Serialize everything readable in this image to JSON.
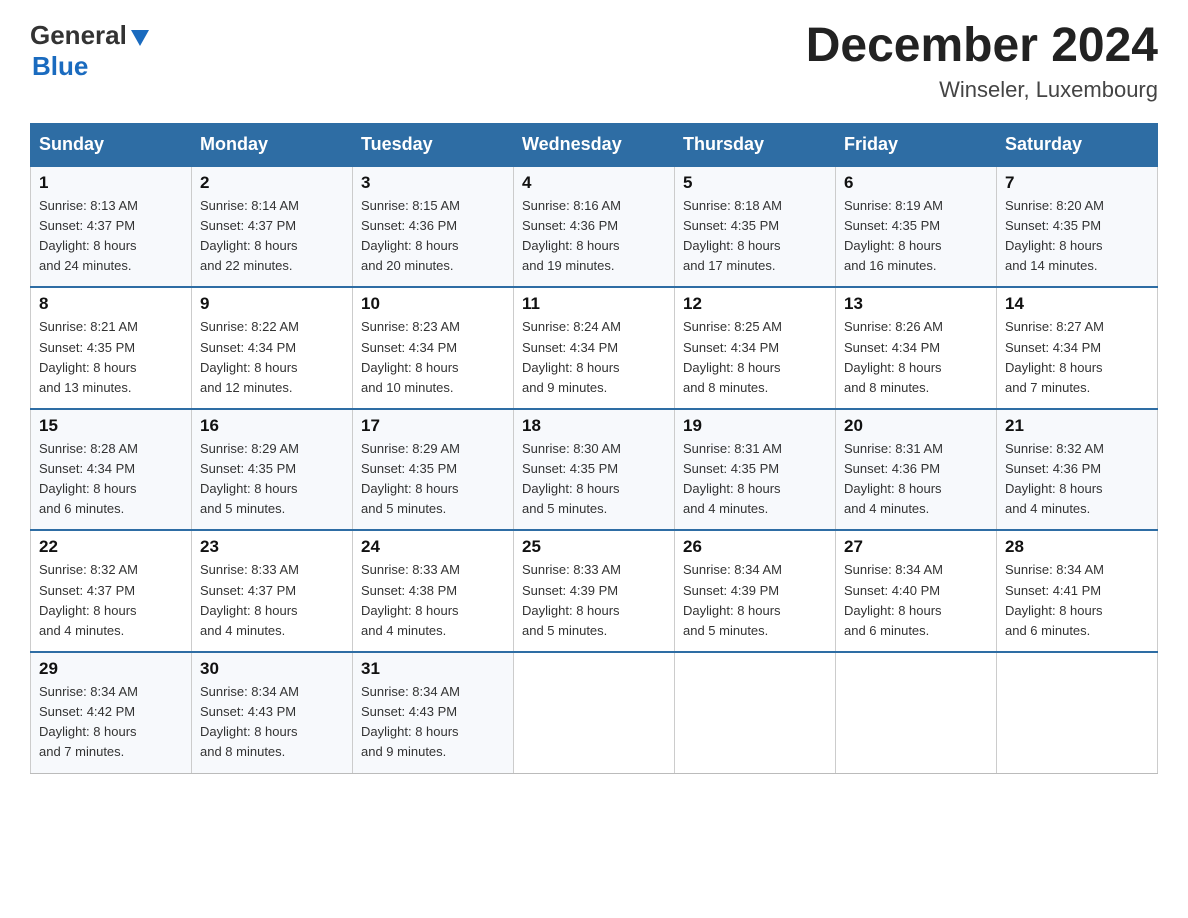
{
  "header": {
    "logo_general": "General",
    "logo_blue": "Blue",
    "main_title": "December 2024",
    "subtitle": "Winseler, Luxembourg"
  },
  "days_of_week": [
    "Sunday",
    "Monday",
    "Tuesday",
    "Wednesday",
    "Thursday",
    "Friday",
    "Saturday"
  ],
  "weeks": [
    [
      {
        "day": "1",
        "sunrise": "8:13 AM",
        "sunset": "4:37 PM",
        "daylight": "8 hours and 24 minutes."
      },
      {
        "day": "2",
        "sunrise": "8:14 AM",
        "sunset": "4:37 PM",
        "daylight": "8 hours and 22 minutes."
      },
      {
        "day": "3",
        "sunrise": "8:15 AM",
        "sunset": "4:36 PM",
        "daylight": "8 hours and 20 minutes."
      },
      {
        "day": "4",
        "sunrise": "8:16 AM",
        "sunset": "4:36 PM",
        "daylight": "8 hours and 19 minutes."
      },
      {
        "day": "5",
        "sunrise": "8:18 AM",
        "sunset": "4:35 PM",
        "daylight": "8 hours and 17 minutes."
      },
      {
        "day": "6",
        "sunrise": "8:19 AM",
        "sunset": "4:35 PM",
        "daylight": "8 hours and 16 minutes."
      },
      {
        "day": "7",
        "sunrise": "8:20 AM",
        "sunset": "4:35 PM",
        "daylight": "8 hours and 14 minutes."
      }
    ],
    [
      {
        "day": "8",
        "sunrise": "8:21 AM",
        "sunset": "4:35 PM",
        "daylight": "8 hours and 13 minutes."
      },
      {
        "day": "9",
        "sunrise": "8:22 AM",
        "sunset": "4:34 PM",
        "daylight": "8 hours and 12 minutes."
      },
      {
        "day": "10",
        "sunrise": "8:23 AM",
        "sunset": "4:34 PM",
        "daylight": "8 hours and 10 minutes."
      },
      {
        "day": "11",
        "sunrise": "8:24 AM",
        "sunset": "4:34 PM",
        "daylight": "8 hours and 9 minutes."
      },
      {
        "day": "12",
        "sunrise": "8:25 AM",
        "sunset": "4:34 PM",
        "daylight": "8 hours and 8 minutes."
      },
      {
        "day": "13",
        "sunrise": "8:26 AM",
        "sunset": "4:34 PM",
        "daylight": "8 hours and 8 minutes."
      },
      {
        "day": "14",
        "sunrise": "8:27 AM",
        "sunset": "4:34 PM",
        "daylight": "8 hours and 7 minutes."
      }
    ],
    [
      {
        "day": "15",
        "sunrise": "8:28 AM",
        "sunset": "4:34 PM",
        "daylight": "8 hours and 6 minutes."
      },
      {
        "day": "16",
        "sunrise": "8:29 AM",
        "sunset": "4:35 PM",
        "daylight": "8 hours and 5 minutes."
      },
      {
        "day": "17",
        "sunrise": "8:29 AM",
        "sunset": "4:35 PM",
        "daylight": "8 hours and 5 minutes."
      },
      {
        "day": "18",
        "sunrise": "8:30 AM",
        "sunset": "4:35 PM",
        "daylight": "8 hours and 5 minutes."
      },
      {
        "day": "19",
        "sunrise": "8:31 AM",
        "sunset": "4:35 PM",
        "daylight": "8 hours and 4 minutes."
      },
      {
        "day": "20",
        "sunrise": "8:31 AM",
        "sunset": "4:36 PM",
        "daylight": "8 hours and 4 minutes."
      },
      {
        "day": "21",
        "sunrise": "8:32 AM",
        "sunset": "4:36 PM",
        "daylight": "8 hours and 4 minutes."
      }
    ],
    [
      {
        "day": "22",
        "sunrise": "8:32 AM",
        "sunset": "4:37 PM",
        "daylight": "8 hours and 4 minutes."
      },
      {
        "day": "23",
        "sunrise": "8:33 AM",
        "sunset": "4:37 PM",
        "daylight": "8 hours and 4 minutes."
      },
      {
        "day": "24",
        "sunrise": "8:33 AM",
        "sunset": "4:38 PM",
        "daylight": "8 hours and 4 minutes."
      },
      {
        "day": "25",
        "sunrise": "8:33 AM",
        "sunset": "4:39 PM",
        "daylight": "8 hours and 5 minutes."
      },
      {
        "day": "26",
        "sunrise": "8:34 AM",
        "sunset": "4:39 PM",
        "daylight": "8 hours and 5 minutes."
      },
      {
        "day": "27",
        "sunrise": "8:34 AM",
        "sunset": "4:40 PM",
        "daylight": "8 hours and 6 minutes."
      },
      {
        "day": "28",
        "sunrise": "8:34 AM",
        "sunset": "4:41 PM",
        "daylight": "8 hours and 6 minutes."
      }
    ],
    [
      {
        "day": "29",
        "sunrise": "8:34 AM",
        "sunset": "4:42 PM",
        "daylight": "8 hours and 7 minutes."
      },
      {
        "day": "30",
        "sunrise": "8:34 AM",
        "sunset": "4:43 PM",
        "daylight": "8 hours and 8 minutes."
      },
      {
        "day": "31",
        "sunrise": "8:34 AM",
        "sunset": "4:43 PM",
        "daylight": "8 hours and 9 minutes."
      },
      null,
      null,
      null,
      null
    ]
  ],
  "labels": {
    "sunrise_prefix": "Sunrise: ",
    "sunset_prefix": "Sunset: ",
    "daylight_prefix": "Daylight: "
  }
}
